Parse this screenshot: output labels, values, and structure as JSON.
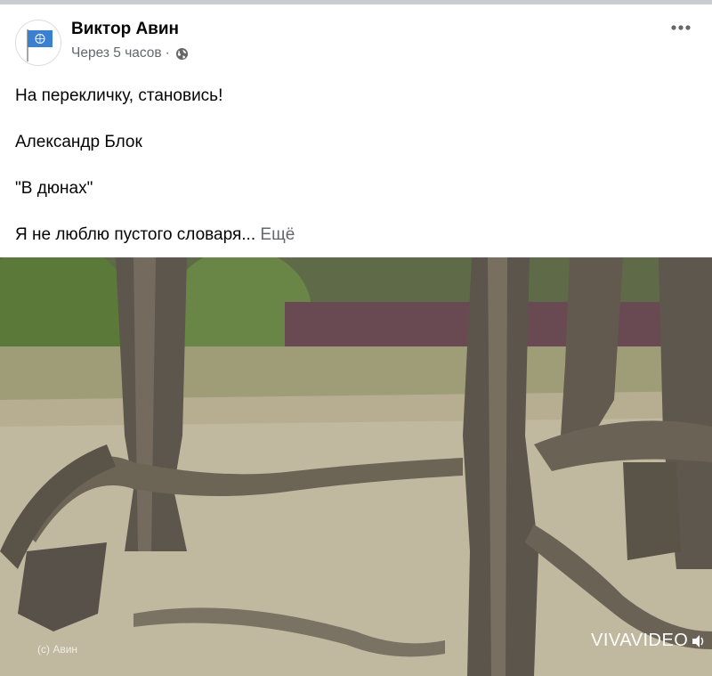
{
  "post": {
    "author": "Виктор Авин",
    "time": "Через 5 часов",
    "separator": "·",
    "privacy_icon": "globe-icon",
    "more_icon": "more-options-icon",
    "avatar_icon": "un-flag-icon",
    "text": {
      "line1": "На перекличку, становись!",
      "line2": "Александр Блок",
      "line3": "\"В дюнах\"",
      "line4": "Я не люблю пустого словаря...",
      "more_label": "Ещё"
    }
  },
  "video": {
    "watermark_left": "(c) Авин",
    "watermark_right": "VIVAVIDEO"
  },
  "colors": {
    "secondary_text": "#65676b",
    "primary_text": "#050505",
    "divider": "#c9ccd1",
    "flag_blue": "#3b7fd1"
  }
}
